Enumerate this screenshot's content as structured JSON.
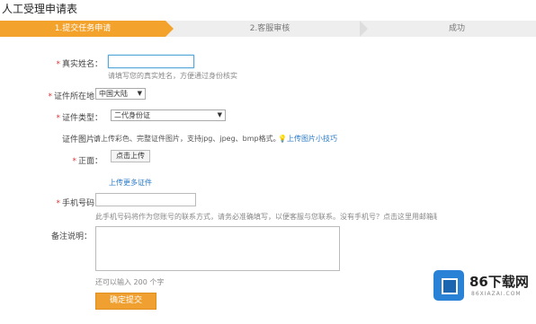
{
  "page": {
    "title": "人工受理申请表"
  },
  "steps": [
    {
      "label": "1.提交任务申请"
    },
    {
      "label": "2.客服审核"
    },
    {
      "label": "成功"
    }
  ],
  "form": {
    "name": {
      "label": "真实姓名：",
      "hint": "请填写您的真实姓名，方便通过身份核实",
      "value": ""
    },
    "region": {
      "label": "证件所在地：",
      "value": "中国大陆"
    },
    "idtype": {
      "label": "证件类型：",
      "value": "二代身份证"
    },
    "photo": {
      "label": "证件图片：",
      "hint": "请上传彩色、完整证件图片，支持jpg、jpeg、bmp格式。",
      "tip": "上传图片小技巧",
      "front_label": "正面：",
      "upload_button": "点击上传",
      "more_link": "上传更多证件"
    },
    "phone": {
      "label": "手机号码：",
      "hint": "此手机号码将作为您账号的联系方式，请务必准确填写，以便客服与您联系。没有手机号？点击这里用邮箱联系客服",
      "link": "点击这里"
    },
    "remark": {
      "label": "备注说明：",
      "counter": "还可以输入 200 个字"
    },
    "submit_label": "确定提交"
  },
  "watermark": {
    "brand": "86下载网",
    "sub": "86XIAZAI.COM"
  },
  "colors": {
    "accent": "#f3a22b",
    "link": "#2a7ac7",
    "required": "#d33333"
  }
}
